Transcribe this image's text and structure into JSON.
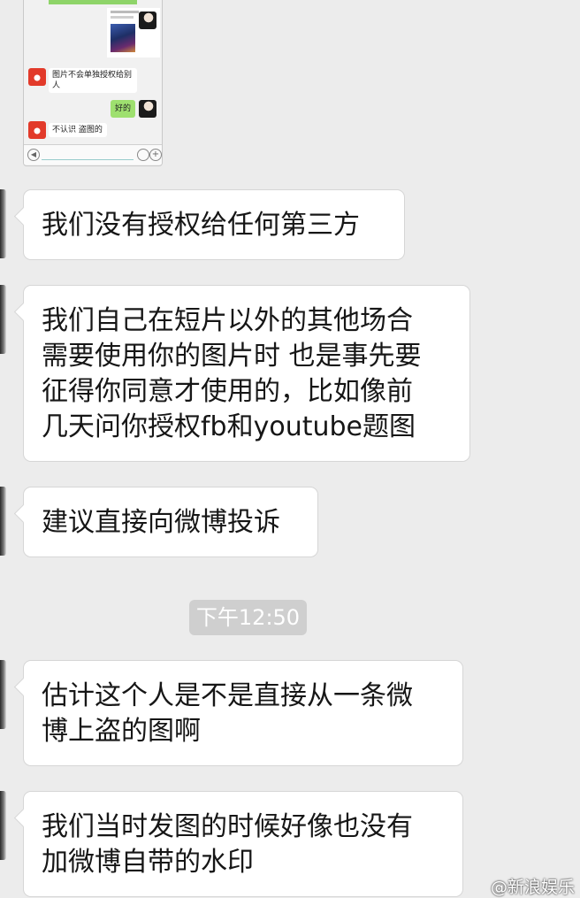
{
  "thumbnail": {
    "messages": [
      "图片不会单独授权给别人",
      "好的",
      "不认识 盗图的"
    ]
  },
  "messages": [
    {
      "lines": [
        "我们没有授权给任何第三方"
      ]
    },
    {
      "lines": [
        "我们自己在短片以外的其他场合",
        "需要使用你的图片时 也是事先要",
        "征得你同意才使用的，比如像前",
        "几天问你授权fb和youtube题图"
      ]
    },
    {
      "lines": [
        "建议直接向微博投诉"
      ]
    },
    {
      "lines": [
        "估计这个人是不是直接从一条微",
        "博上盗的图啊"
      ]
    },
    {
      "lines": [
        "我们当时发图的时候好像也没有",
        "加微博自带的水印"
      ]
    }
  ],
  "timestamp": "下午12:50",
  "watermark": "@新浪娱乐",
  "colors": {
    "background": "#ececec",
    "bubble": "#ffffff",
    "time_pill": "#cfcfcf",
    "self_bubble_green": "#9ee06f"
  }
}
